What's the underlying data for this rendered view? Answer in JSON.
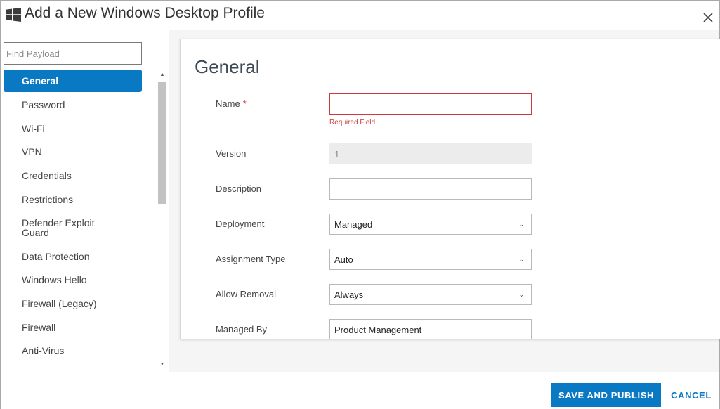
{
  "window": {
    "title": "Add a New Windows Desktop Profile"
  },
  "icons": {
    "app": "windows-logo-icon",
    "close": "close-icon",
    "scroll_up": "scroll-up-arrow-icon",
    "scroll_down": "scroll-down-arrow-icon",
    "dropdown": "chevron-down-icon"
  },
  "sidebar": {
    "search_placeholder": "Find Payload",
    "search_value": "",
    "items": [
      {
        "label": "General",
        "active": true
      },
      {
        "label": "Password"
      },
      {
        "label": "Wi-Fi"
      },
      {
        "label": "VPN"
      },
      {
        "label": "Credentials"
      },
      {
        "label": "Restrictions"
      },
      {
        "label": "Defender Exploit Guard"
      },
      {
        "label": "Data Protection"
      },
      {
        "label": "Windows Hello"
      },
      {
        "label": "Firewall (Legacy)"
      },
      {
        "label": "Firewall"
      },
      {
        "label": "Anti-Virus"
      }
    ]
  },
  "form": {
    "section_title": "General",
    "name": {
      "label": "Name",
      "required_marker": "*",
      "value": "",
      "error": "Required Field"
    },
    "version": {
      "label": "Version",
      "value": "1"
    },
    "description": {
      "label": "Description",
      "value": ""
    },
    "deployment": {
      "label": "Deployment",
      "value": "Managed"
    },
    "assignment_type": {
      "label": "Assignment Type",
      "value": "Auto"
    },
    "allow_removal": {
      "label": "Allow Removal",
      "value": "Always"
    },
    "managed_by": {
      "label": "Managed By",
      "value": "Product Management"
    }
  },
  "footer": {
    "save_publish_label": "SAVE AND PUBLISH",
    "cancel_label": "CANCEL"
  },
  "colors": {
    "accent": "#0a79c4",
    "error": "#d0393a"
  }
}
